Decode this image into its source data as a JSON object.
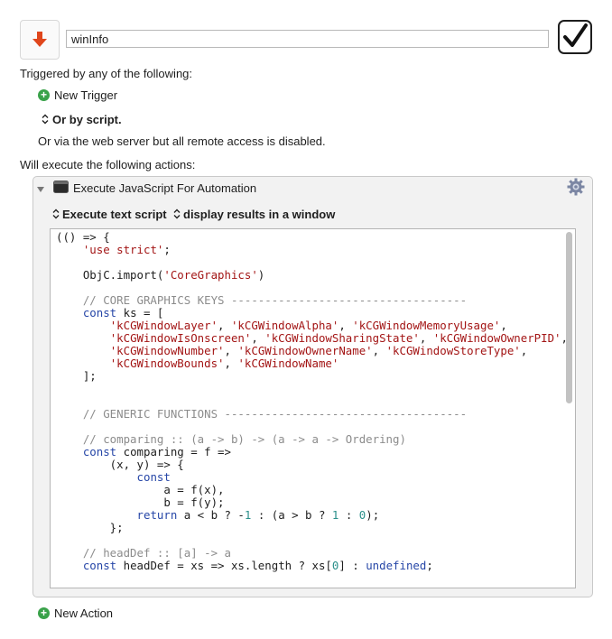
{
  "macro": {
    "name_value": "winInfo",
    "icon": "down-arrow-icon",
    "enabled": true
  },
  "triggers": {
    "heading": "Triggered by any of the following:",
    "new_trigger_label": "New Trigger",
    "or_by_script_label": "Or by script.",
    "web_server_note": "Or via the web server but all remote access is disabled."
  },
  "actions": {
    "heading": "Will execute the following actions:",
    "new_action_label": "New Action",
    "action": {
      "title": "Execute JavaScript For Automation",
      "mode_label": "Execute text script",
      "output_label": "display results in a window",
      "code_lines": [
        [
          {
            "t": "(() => {",
            "c": "p"
          }
        ],
        [
          {
            "t": "    ",
            "c": "p"
          },
          {
            "t": "'use strict'",
            "c": "s"
          },
          {
            "t": ";",
            "c": "p"
          }
        ],
        [],
        [
          {
            "t": "    ObjC.import(",
            "c": "p"
          },
          {
            "t": "'CoreGraphics'",
            "c": "s"
          },
          {
            "t": ")",
            "c": "p"
          }
        ],
        [],
        [
          {
            "t": "    // CORE GRAPHICS KEYS -----------------------------------",
            "c": "m"
          }
        ],
        [
          {
            "t": "    ",
            "c": "p"
          },
          {
            "t": "const",
            "c": "k"
          },
          {
            "t": " ks = [",
            "c": "p"
          }
        ],
        [
          {
            "t": "        ",
            "c": "p"
          },
          {
            "t": "'kCGWindowLayer'",
            "c": "s"
          },
          {
            "t": ", ",
            "c": "p"
          },
          {
            "t": "'kCGWindowAlpha'",
            "c": "s"
          },
          {
            "t": ", ",
            "c": "p"
          },
          {
            "t": "'kCGWindowMemoryUsage'",
            "c": "s"
          },
          {
            "t": ",",
            "c": "p"
          }
        ],
        [
          {
            "t": "        ",
            "c": "p"
          },
          {
            "t": "'kCGWindowIsOnscreen'",
            "c": "s"
          },
          {
            "t": ", ",
            "c": "p"
          },
          {
            "t": "'kCGWindowSharingState'",
            "c": "s"
          },
          {
            "t": ", ",
            "c": "p"
          },
          {
            "t": "'kCGWindowOwnerPID'",
            "c": "s"
          },
          {
            "t": ",",
            "c": "p"
          }
        ],
        [
          {
            "t": "        ",
            "c": "p"
          },
          {
            "t": "'kCGWindowNumber'",
            "c": "s"
          },
          {
            "t": ", ",
            "c": "p"
          },
          {
            "t": "'kCGWindowOwnerName'",
            "c": "s"
          },
          {
            "t": ", ",
            "c": "p"
          },
          {
            "t": "'kCGWindowStoreType'",
            "c": "s"
          },
          {
            "t": ",",
            "c": "p"
          }
        ],
        [
          {
            "t": "        ",
            "c": "p"
          },
          {
            "t": "'kCGWindowBounds'",
            "c": "s"
          },
          {
            "t": ", ",
            "c": "p"
          },
          {
            "t": "'kCGWindowName'",
            "c": "s"
          }
        ],
        [
          {
            "t": "    ];",
            "c": "p"
          }
        ],
        [],
        [],
        [
          {
            "t": "    // GENERIC FUNCTIONS ------------------------------------",
            "c": "m"
          }
        ],
        [],
        [
          {
            "t": "    // comparing :: (a -> b) -> (a -> a -> Ordering)",
            "c": "m"
          }
        ],
        [
          {
            "t": "    ",
            "c": "p"
          },
          {
            "t": "const",
            "c": "k"
          },
          {
            "t": " comparing = f =>",
            "c": "p"
          }
        ],
        [
          {
            "t": "        (x, y) => {",
            "c": "p"
          }
        ],
        [
          {
            "t": "            ",
            "c": "p"
          },
          {
            "t": "const",
            "c": "k"
          }
        ],
        [
          {
            "t": "                a = f(x),",
            "c": "p"
          }
        ],
        [
          {
            "t": "                b = f(y);",
            "c": "p"
          }
        ],
        [
          {
            "t": "            ",
            "c": "p"
          },
          {
            "t": "return",
            "c": "k"
          },
          {
            "t": " a < b ? -",
            "c": "p"
          },
          {
            "t": "1",
            "c": "n"
          },
          {
            "t": " : (a > b ? ",
            "c": "p"
          },
          {
            "t": "1",
            "c": "n"
          },
          {
            "t": " : ",
            "c": "p"
          },
          {
            "t": "0",
            "c": "n"
          },
          {
            "t": ");",
            "c": "p"
          }
        ],
        [
          {
            "t": "        };",
            "c": "p"
          }
        ],
        [],
        [
          {
            "t": "    // headDef :: [a] -> a",
            "c": "m"
          }
        ],
        [
          {
            "t": "    ",
            "c": "p"
          },
          {
            "t": "const",
            "c": "k"
          },
          {
            "t": " headDef = xs => xs.length ? xs[",
            "c": "p"
          },
          {
            "t": "0",
            "c": "n"
          },
          {
            "t": "] : ",
            "c": "p"
          },
          {
            "t": "undefined",
            "c": "k"
          },
          {
            "t": ";",
            "c": "p"
          }
        ]
      ]
    }
  },
  "colors": {
    "keyword": "#2646a7",
    "string": "#a31515",
    "number": "#2a8f8a",
    "comment": "#8c8c8c",
    "macro_icon": "#e0461c",
    "add_icon": "#3aa24a"
  }
}
